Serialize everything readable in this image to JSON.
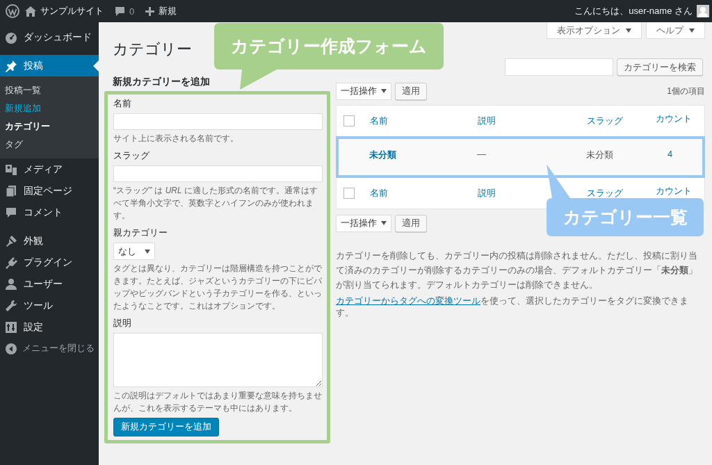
{
  "admin_bar": {
    "site": "サンプルサイト",
    "comments": "0",
    "new": "新規",
    "greeting": "こんにちは、user-name さん"
  },
  "sidebar": {
    "items": [
      {
        "label": "ダッシュボード",
        "selected": false
      },
      {
        "label": "投稿",
        "selected": true,
        "children": [
          {
            "label": "投稿一覧",
            "selected": false,
            "hovered": false
          },
          {
            "label": "新規追加",
            "selected": false,
            "hovered": true
          },
          {
            "label": "カテゴリー",
            "selected": true,
            "hovered": false
          },
          {
            "label": "タグ",
            "selected": false,
            "hovered": false
          }
        ]
      },
      {
        "label": "メディア",
        "selected": false
      },
      {
        "label": "固定ページ",
        "selected": false
      },
      {
        "label": "コメント",
        "selected": false
      },
      {
        "label": "外観",
        "selected": false
      },
      {
        "label": "プラグイン",
        "selected": false
      },
      {
        "label": "ユーザー",
        "selected": false
      },
      {
        "label": "ツール",
        "selected": false
      },
      {
        "label": "設定",
        "selected": false
      },
      {
        "label": "メニューを閉じる",
        "selected": false
      }
    ]
  },
  "screen_tabs": [
    "表示オプション",
    "ヘルプ"
  ],
  "page_title": "カテゴリー",
  "search": {
    "button": "カテゴリーを検索"
  },
  "add_form": {
    "heading": "新規カテゴリーを追加",
    "fields": [
      {
        "kind": "text",
        "label": "名前",
        "help": "サイト上に表示される名前です。"
      },
      {
        "kind": "text",
        "label": "スラッグ",
        "help": "“スラッグ” は *URL* に適した形式の名前です。通常はすべて半角小文字で、英数字とハイフンのみが使われます。"
      },
      {
        "kind": "select",
        "label": "親カテゴリー",
        "value": "なし",
        "help": "タグとは異なり、カテゴリーは階層構造を持つことができます。たとえば、ジャズというカテゴリーの下にビバップやビッグバンドという子カテゴリーを作る、といったようなことです。これはオプションです。"
      },
      {
        "kind": "textarea",
        "label": "説明",
        "help": "この説明はデフォルトではあまり重要な意味を持ちませんが、これを表示するテーマも中にはあります。"
      }
    ],
    "submit": "新規カテゴリーを追加"
  },
  "list": {
    "bulk_top": {
      "select": "一括操作",
      "apply": "適用"
    },
    "item_count": "1個の項目",
    "columns": [
      "名前",
      "説明",
      "スラッグ",
      "カウント"
    ],
    "header_checked": false,
    "rows": [
      {
        "name": "未分類",
        "description": "—",
        "slug": "未分類",
        "count": "4"
      }
    ],
    "footer_columns": [
      "名前",
      "説明",
      "スラッグ",
      "カウント"
    ],
    "footer_checked": false,
    "bulk_bottom": {
      "select": "一括操作",
      "apply": "適用"
    },
    "notice": "カテゴリーを削除しても、カテゴリー内の投稿は削除されません。ただし、投稿に割り当て済みのカテゴリーが削除するカテゴリーのみの場合、デフォルトカテゴリー「**未分類**」が割り当てられます。デフォルトカテゴリーは削除できません。",
    "convert_link": "カテゴリーからタグへの変換ツール",
    "convert_text": "を使って、選択したカテゴリーをタグに変換できます。"
  },
  "annotations": [
    {
      "text": "カテゴリー作成フォーム",
      "color": "#a8d08d"
    },
    {
      "text": "カテゴリー一覧",
      "color": "#99c8f5"
    }
  ]
}
